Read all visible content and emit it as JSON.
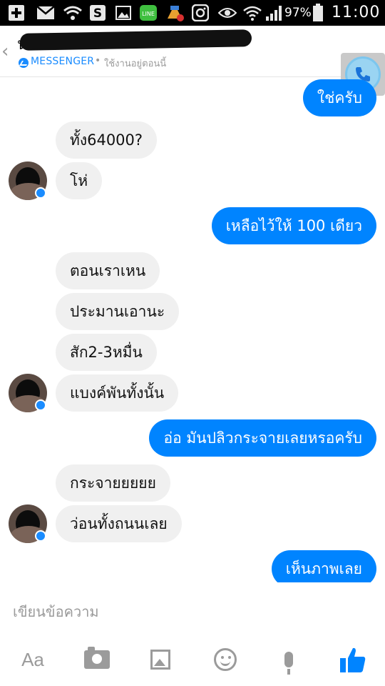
{
  "status_bar": {
    "battery_percent": "97%",
    "time": "11:00",
    "icons": [
      "plus-icon",
      "mail-icon",
      "wifi-signal-icon",
      "s-app-icon",
      "image-icon",
      "line-app-icon",
      "cleaner-icon",
      "instagram-icon",
      "eye-icon",
      "wifi-icon",
      "cell-signal-icon",
      "battery-icon"
    ]
  },
  "header": {
    "contact_name": "น...ฯ...n",
    "service": "MESSENGER",
    "separator": "•",
    "presence": "ใช้งานอยู่ตอนนี้"
  },
  "thread": {
    "messages": [
      {
        "side": "sent",
        "text": "ใช่ครับ"
      },
      {
        "side": "received",
        "text": "ทั้ง64000?"
      },
      {
        "side": "received",
        "text": "โห่"
      },
      {
        "side": "sent",
        "text": "เหลือไว้ให้ 100 เดียว"
      },
      {
        "side": "received",
        "text": "ตอนเราเหน"
      },
      {
        "side": "received",
        "text": "ประมานเอานะ"
      },
      {
        "side": "received",
        "text": "สัก2-3หมื่น"
      },
      {
        "side": "received",
        "text": "แบงค์พันทั้งนั้น"
      },
      {
        "side": "sent",
        "text": "อ่อ มันปลิวกระจายเลยหรอครับ"
      },
      {
        "side": "received",
        "text": "กระจายยยยย"
      },
      {
        "side": "received",
        "text": "ว่อนทั้งถนนเลย"
      },
      {
        "side": "sent",
        "text": "เห็นภาพเลย"
      }
    ]
  },
  "composer": {
    "placeholder": "เขียนข้อความ",
    "text_button": "Aa"
  },
  "colors": {
    "accent": "#0084ff",
    "received_bubble": "#f0f0f0"
  }
}
